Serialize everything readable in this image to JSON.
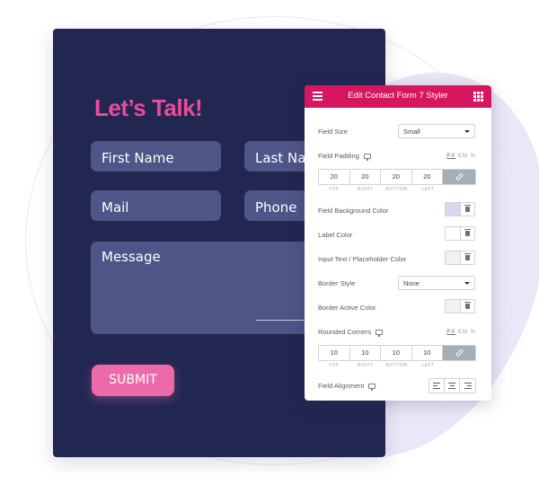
{
  "form": {
    "title": "Let’s Talk!",
    "fields": {
      "first_name": "First Name",
      "last_name": "Last Name",
      "mail": "Mail",
      "phone": "Phone",
      "message": "Message"
    },
    "submit_label": "SUBMIT",
    "colors": {
      "background": "#222752",
      "title": "#ec4a9b",
      "field": "#4e5587",
      "submit": "#ec6aa9"
    }
  },
  "panel": {
    "title": "Edit Contact Form 7 Styler",
    "header_color": "#d6175f",
    "field_size": {
      "label": "Field Size",
      "value": "Small"
    },
    "field_padding": {
      "label": "Field Padding",
      "units": [
        "PX",
        "EM",
        "%"
      ],
      "values": [
        "20",
        "20",
        "20",
        "20"
      ],
      "sides": [
        "TOP",
        "RIGHT",
        "BOTTOM",
        "LEFT"
      ]
    },
    "field_background_color": {
      "label": "Field Background Color"
    },
    "label_color": {
      "label": "Label Color"
    },
    "input_text_color": {
      "label": "Input Text / Placeholder Color"
    },
    "border_style": {
      "label": "Border Style",
      "value": "None"
    },
    "border_active_color": {
      "label": "Border Active Color"
    },
    "rounded_corners": {
      "label": "Rounded Corners",
      "units": [
        "PX",
        "EM",
        "%"
      ],
      "values": [
        "10",
        "10",
        "10",
        "10"
      ],
      "sides": [
        "TOP",
        "RIGHT",
        "BOTTOM",
        "LEFT"
      ]
    },
    "field_alignment": {
      "label": "Field Alignment"
    }
  }
}
